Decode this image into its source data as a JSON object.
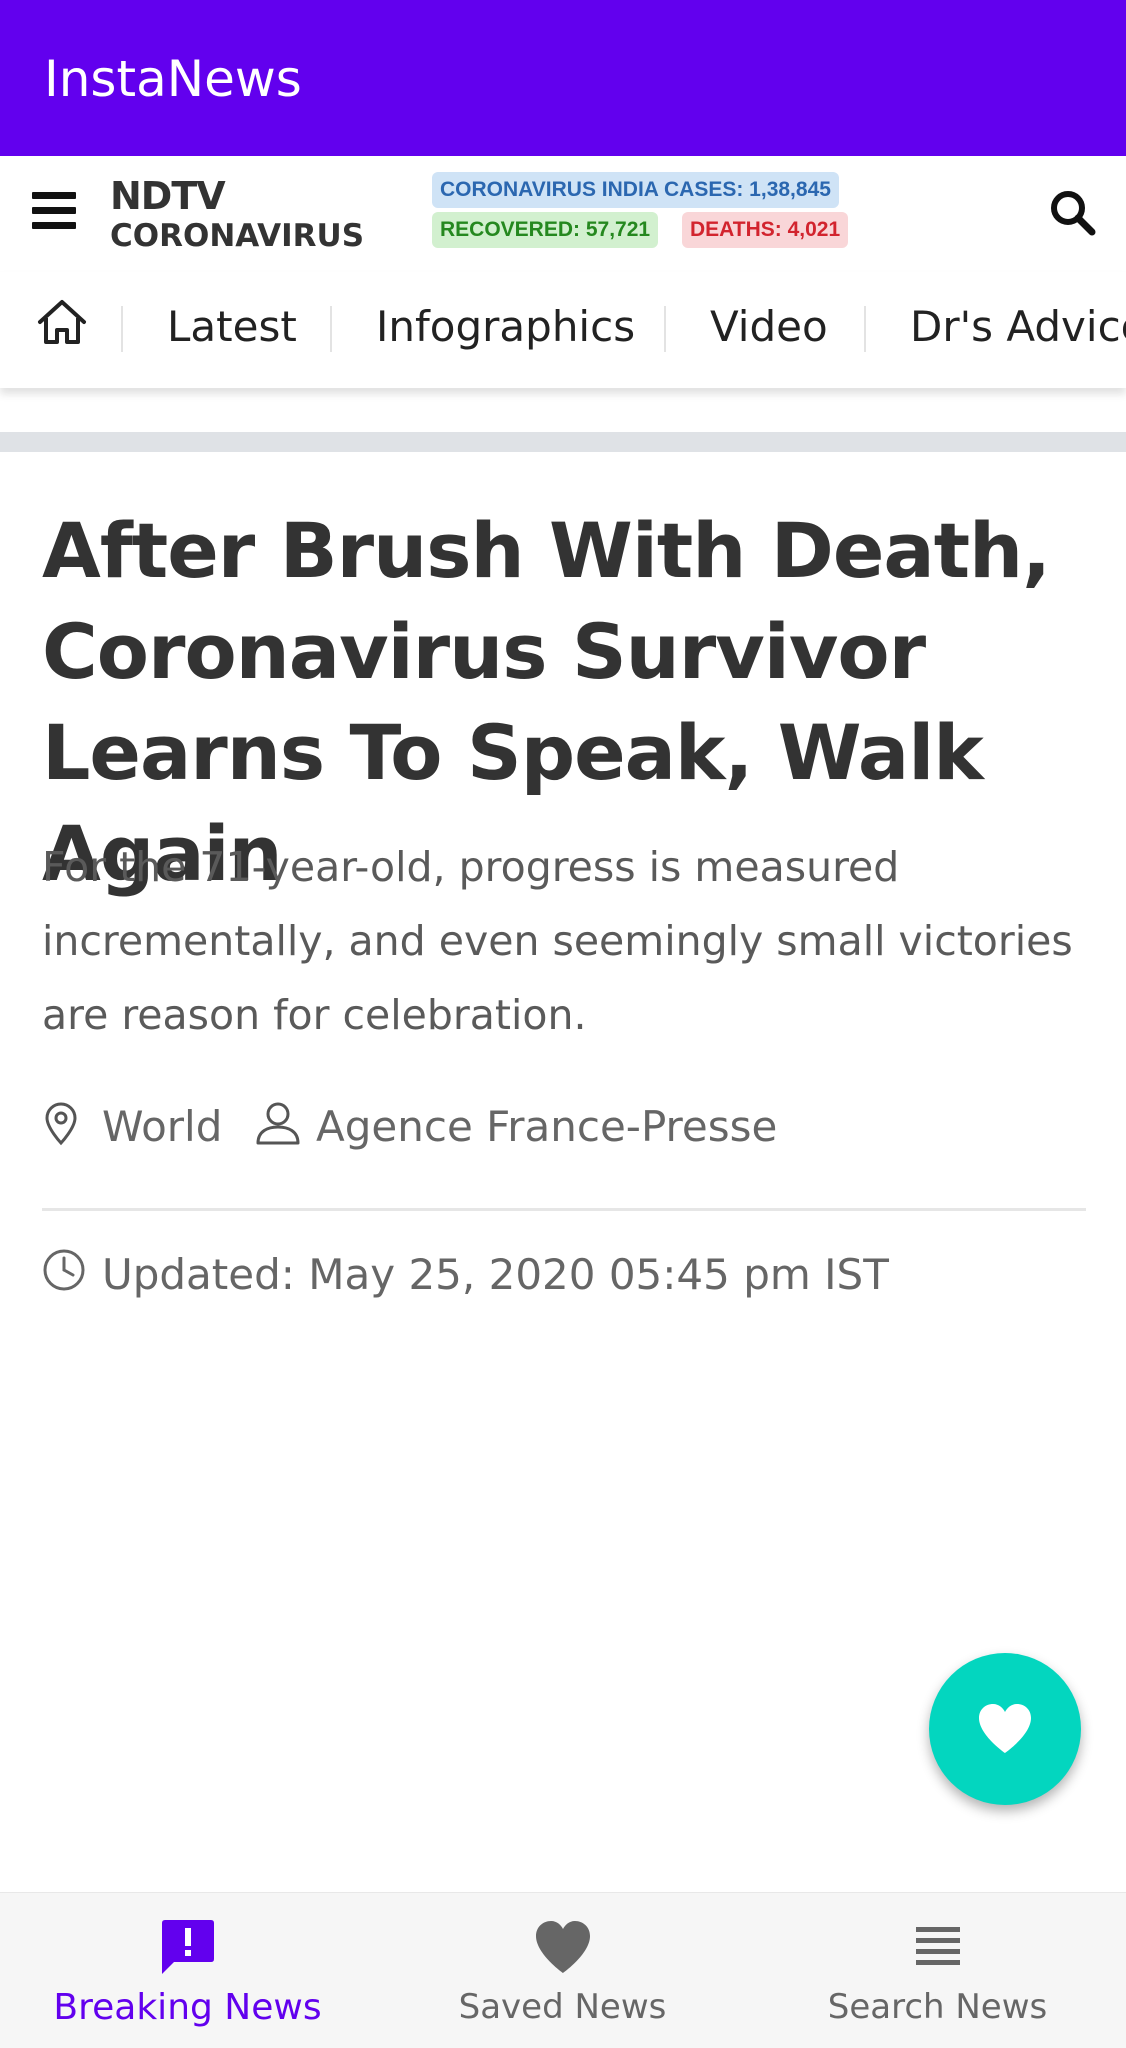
{
  "app_bar": {
    "title": "InstaNews"
  },
  "site_header": {
    "logo_top": "NDTV",
    "logo_bottom": "CORONAVIRUS",
    "stats": {
      "cases": "CORONAVIRUS INDIA CASES: 1,38,845",
      "recovered": "RECOVERED: 57,721",
      "deaths": "DEATHS: 4,021"
    },
    "icons": {
      "menu": "hamburger-menu-icon",
      "search": "search-icon"
    }
  },
  "category_nav": {
    "home_icon": "home-icon",
    "tabs": [
      {
        "label": "Latest"
      },
      {
        "label": "Infographics"
      },
      {
        "label": "Video"
      },
      {
        "label": "Dr's Advice"
      }
    ]
  },
  "article": {
    "headline": "After Brush With Death, Coronavirus Survivor Learns To Speak, Walk Again",
    "summary": "For the 71-year-old, progress is measured incrementally, and even seemingly small victories are reason for celebration.",
    "location": "World",
    "author": "Agence France-Presse",
    "updated": "Updated: May 25, 2020 05:45 pm IST"
  },
  "fab": {
    "icon": "heart-icon"
  },
  "bottom_nav": {
    "items": [
      {
        "label": "Breaking News",
        "icon": "alert-message-icon",
        "active": true
      },
      {
        "label": "Saved News",
        "icon": "heart-icon",
        "active": false
      },
      {
        "label": "Search News",
        "icon": "list-icon",
        "active": false
      }
    ]
  },
  "colors": {
    "primary": "#6200ee",
    "fab": "#03d6bf",
    "cases_text": "#2b67b0",
    "recovered_text": "#25881f",
    "deaths_text": "#d2242e"
  }
}
